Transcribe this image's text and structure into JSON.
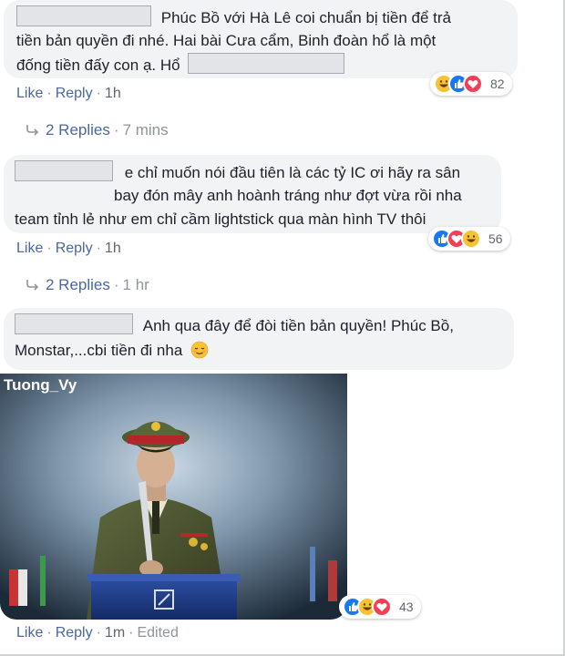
{
  "comments": [
    {
      "text_lines": [
        "Phúc Bồ với Hà Lê coi chuẩn bị tiền để trả",
        "tiền bản quyền đi nhé. Hai bài Cưa cẩm, Binh đoàn hổ là một",
        "đống tiền đấy con ạ. Hổ"
      ],
      "like": "Like",
      "reply": "Reply",
      "time": "1h",
      "reaction_count": "82",
      "replies_label": "2 Replies",
      "replies_time": "7 mins"
    },
    {
      "text_lines": [
        "e chỉ muốn nói đầu tiên là các tỷ IC ơi hãy ra sân",
        "bay đón mây anh hoành tráng như đợt vừa rồi nha",
        "team tỉnh lẻ như em chỉ cầm lightstick qua màn hình TV thôi"
      ],
      "like": "Like",
      "reply": "Reply",
      "time": "1h",
      "reaction_count": "56",
      "replies_label": "2 Replies",
      "replies_time": "1 hr"
    },
    {
      "text_lines": [
        "Anh qua đây để đòi tiền bản quyền! Phúc Bồ,",
        "Monstar,...cbi tiền đi nha"
      ],
      "photo_watermark": "Tuong_Vy",
      "like": "Like",
      "reply": "Reply",
      "time": "1m",
      "edited": "Edited",
      "reaction_count": "43"
    }
  ],
  "icons": {
    "reply_arrow": "reply-arrow-icon",
    "haha": "haha-reaction-icon",
    "like": "like-reaction-icon",
    "love": "love-reaction-icon",
    "emoji": "relieved-face-emoji"
  },
  "colors": {
    "link": "#4b67a1",
    "meta": "#90949c",
    "bubble": "#f2f3f5",
    "like_blue": "#1877f2",
    "love_red": "#f33e58",
    "haha_yellow": "#f7c233"
  }
}
